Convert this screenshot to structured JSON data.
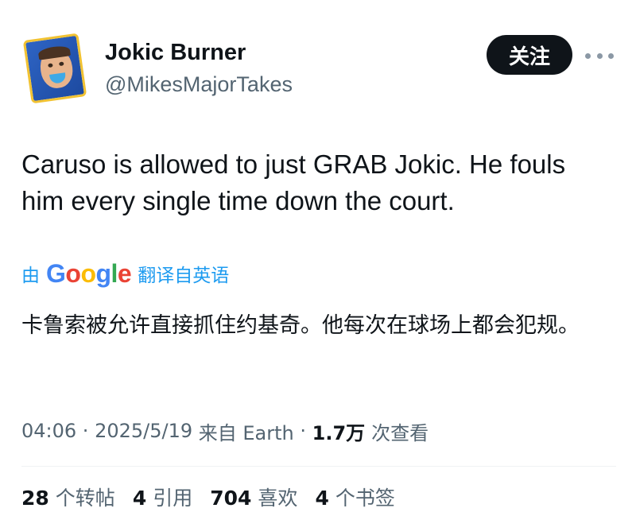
{
  "author": {
    "display_name": "Jokic Burner",
    "handle": "@MikesMajorTakes",
    "avatar_icon": "cartoon-face-avatar"
  },
  "actions": {
    "follow_label": "关注",
    "more_icon": "more-horizontal-icon"
  },
  "tweet": {
    "text": "Caruso is allowed to just GRAB Jokic. He fouls him every single time down the court.",
    "translation": {
      "by_label": "由",
      "provider": "Google",
      "from_label": "翻译自英语",
      "text": "卡鲁索被允许直接抓住约基奇。他每次在球场上都会犯规。"
    }
  },
  "meta": {
    "time": "04:06",
    "sep1": " · ",
    "date": "2025/5/19",
    "source": " 来自 Earth",
    "sep2": " · ",
    "views": "1.7万",
    "views_label": "次查看"
  },
  "stats": [
    {
      "num": "28",
      "label": "个转帖"
    },
    {
      "num": "4",
      "label": "引用"
    },
    {
      "num": "704",
      "label": "喜欢"
    },
    {
      "num": "4",
      "label": "个书签"
    }
  ],
  "colors": {
    "accent": "#1d9bf0",
    "text": "#0f1419",
    "secondary": "#536471",
    "button_bg": "#0f1419"
  }
}
